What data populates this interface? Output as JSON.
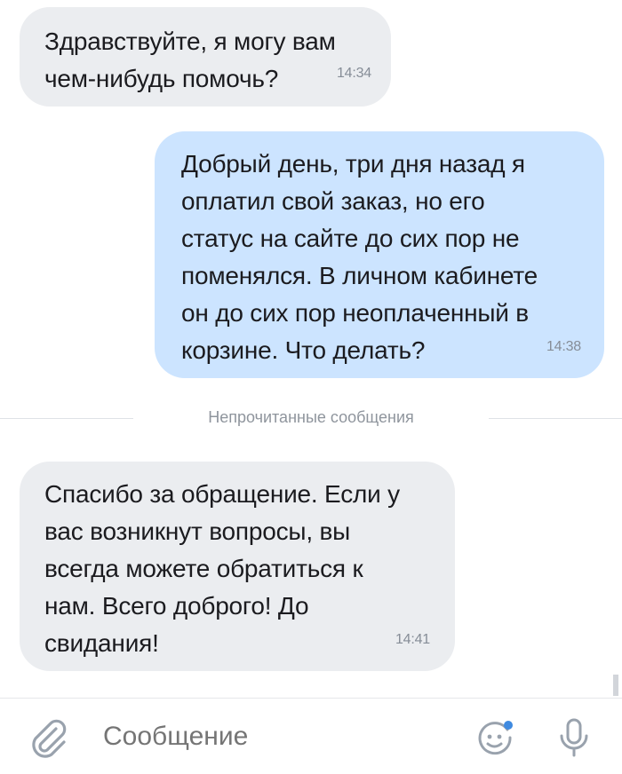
{
  "messages": [
    {
      "direction": "incoming",
      "text": "Здравствуйте, я могу вам\nчем-нибудь помочь?",
      "time": "14:34"
    },
    {
      "direction": "outgoing",
      "text": "Добрый день, три дня назад я\nоплатил свой заказ, но его\nстатус на сайте до сих пор не\nпоменялся. В личном кабинете\nон до сих пор неоплаченный в\nкорзине. Что делать?",
      "time": "14:38"
    },
    {
      "direction": "incoming",
      "text": "Спасибо за обращение. Если у\nвас возникнут вопросы, вы\nвсегда можете обратиться к\nнам. Всего доброго! До\nсвидания!",
      "time": "14:41"
    }
  ],
  "divider": {
    "label": "Непрочитанные сообщения"
  },
  "composer": {
    "placeholder": "Сообщение",
    "icons": {
      "attach": "paperclip-icon",
      "emoji": "emoji-icon",
      "mic": "microphone-icon"
    },
    "accent_color": "#3f8ae0",
    "icon_color": "#99a2ad"
  },
  "colors": {
    "incoming_bubble": "#ebedf0",
    "outgoing_bubble": "#cce4ff",
    "time_text": "#868d97"
  }
}
